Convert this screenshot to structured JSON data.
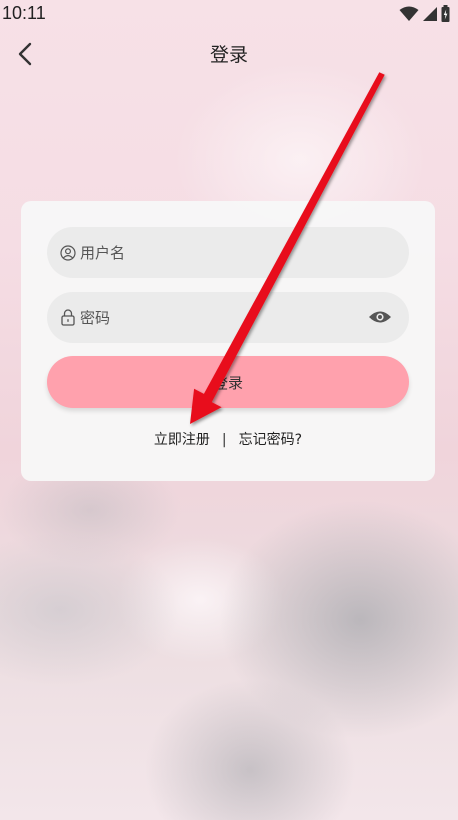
{
  "status_bar": {
    "time": "10:11"
  },
  "nav": {
    "title": "登录"
  },
  "form": {
    "username_placeholder": "用户名",
    "password_placeholder": "密码",
    "login_label": "登录",
    "register_label": "立即注册",
    "separator": "|",
    "forgot_label": "忘记密码?"
  },
  "icons": {
    "back": "chevron-left-icon",
    "user": "user-icon",
    "lock": "lock-icon",
    "eye": "eye-icon",
    "wifi": "wifi-icon",
    "signal": "signal-icon",
    "battery": "battery-icon"
  },
  "colors": {
    "login_button": "#ffa1ad",
    "annotation_arrow": "#e8101b"
  }
}
